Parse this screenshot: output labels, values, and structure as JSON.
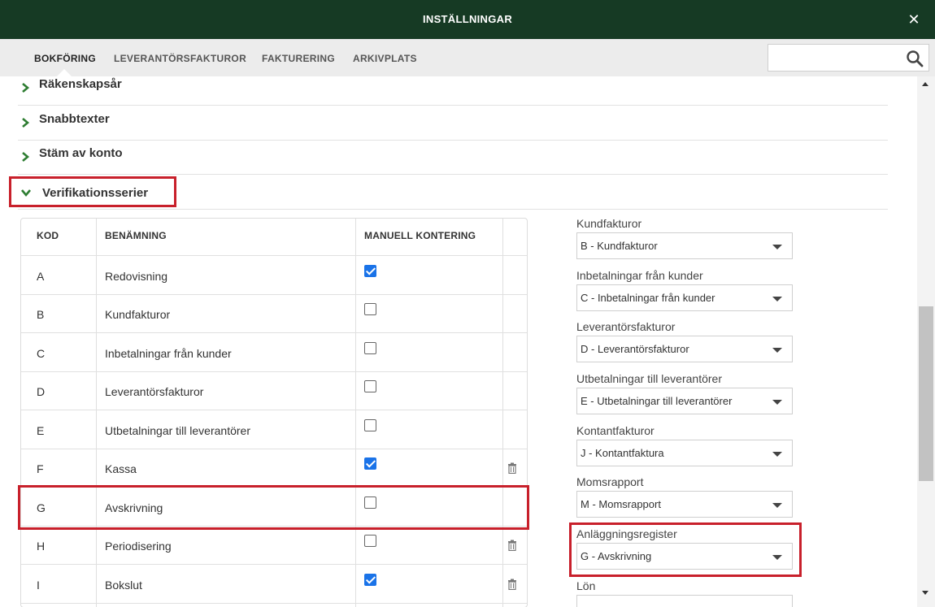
{
  "window": {
    "title": "INSTÄLLNINGAR",
    "close_icon": "close-icon"
  },
  "tabs": [
    {
      "label": "BOKFÖRING",
      "active": true
    },
    {
      "label": "LEVERANTÖRSFAKTUROR",
      "active": false
    },
    {
      "label": "FAKTURERING",
      "active": false
    },
    {
      "label": "ARKIVPLATS",
      "active": false
    }
  ],
  "search": {
    "value": "",
    "placeholder": "",
    "icon": "search-icon"
  },
  "sections": [
    {
      "label": "Räkenskapsår",
      "expanded": false
    },
    {
      "label": "Snabbtexter",
      "expanded": false
    },
    {
      "label": "Stäm av konto",
      "expanded": false
    },
    {
      "label": "Verifikationsserier",
      "expanded": true
    }
  ],
  "table": {
    "headers": {
      "code": "KOD",
      "name": "BENÄMNING",
      "manual": "MANUELL KONTERING"
    },
    "rows": [
      {
        "code": "A",
        "name": "Redovisning",
        "manual": true,
        "deletable": false
      },
      {
        "code": "B",
        "name": "Kundfakturor",
        "manual": false,
        "deletable": false
      },
      {
        "code": "C",
        "name": "Inbetalningar från kunder",
        "manual": false,
        "deletable": false
      },
      {
        "code": "D",
        "name": "Leverantörsfakturor",
        "manual": false,
        "deletable": false
      },
      {
        "code": "E",
        "name": "Utbetalningar till leverantörer",
        "manual": false,
        "deletable": false
      },
      {
        "code": "F",
        "name": "Kassa",
        "manual": true,
        "deletable": true
      },
      {
        "code": "G",
        "name": "Avskrivning",
        "manual": false,
        "deletable": false
      },
      {
        "code": "H",
        "name": "Periodisering",
        "manual": false,
        "deletable": true
      },
      {
        "code": "I",
        "name": "Bokslut",
        "manual": true,
        "deletable": true
      }
    ]
  },
  "series_fields": [
    {
      "label": "Kundfakturor",
      "value": "B - Kundfakturor"
    },
    {
      "label": "Inbetalningar från kunder",
      "value": "C - Inbetalningar från kunder"
    },
    {
      "label": "Leverantörsfakturor",
      "value": "D - Leverantörsfakturor"
    },
    {
      "label": "Utbetalningar till leverantörer",
      "value": "E - Utbetalningar till leverantörer"
    },
    {
      "label": "Kontantfakturor",
      "value": "J - Kontantfaktura"
    },
    {
      "label": "Momsrapport",
      "value": "M - Momsrapport"
    },
    {
      "label": "Anläggningsregister",
      "value": "G - Avskrivning"
    },
    {
      "label": "Lön",
      "value": ""
    }
  ],
  "colors": {
    "header_bg": "#163a24",
    "accent_green": "#2e7d32",
    "highlight_red": "#c8202b",
    "checkbox_blue": "#1a73e8"
  }
}
